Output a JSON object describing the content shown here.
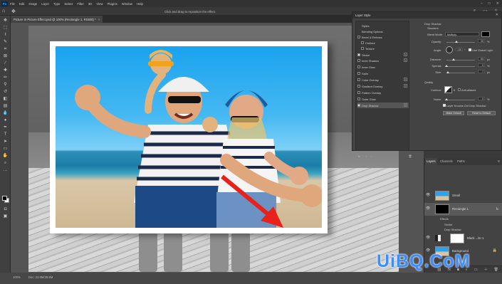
{
  "app": {
    "logo": "Ps",
    "menu": [
      "File",
      "Edit",
      "Image",
      "Layer",
      "Type",
      "Select",
      "Filter",
      "3D",
      "View",
      "Plugins",
      "Window",
      "Help"
    ],
    "window_buttons": [
      "–",
      "□",
      "✕"
    ]
  },
  "options_bar": {
    "hint": "Click and drag to reposition the effect."
  },
  "document_tab": {
    "title": "Picture In Picture Effect.psd @ 100% (Rectangle 1, RGB/8) *",
    "close": "×"
  },
  "layer_style": {
    "title": "Layer Style",
    "close": "✕",
    "list": [
      {
        "label": "Styles",
        "checkbox": false,
        "checked": false,
        "plus": false,
        "selected": false
      },
      {
        "label": "Blending Options",
        "checkbox": false,
        "checked": false,
        "plus": false,
        "selected": false
      },
      {
        "label": "Bevel & Emboss",
        "checkbox": true,
        "checked": false,
        "plus": false,
        "selected": false
      },
      {
        "label": "Contour",
        "checkbox": true,
        "checked": false,
        "plus": false,
        "selected": false
      },
      {
        "label": "Texture",
        "checkbox": true,
        "checked": false,
        "plus": false,
        "selected": false
      },
      {
        "label": "Stroke",
        "checkbox": true,
        "checked": true,
        "plus": true,
        "selected": false
      },
      {
        "label": "Inner Shadow",
        "checkbox": true,
        "checked": false,
        "plus": true,
        "selected": false
      },
      {
        "label": "Inner Glow",
        "checkbox": true,
        "checked": false,
        "plus": false,
        "selected": false
      },
      {
        "label": "Satin",
        "checkbox": true,
        "checked": false,
        "plus": false,
        "selected": false
      },
      {
        "label": "Color Overlay",
        "checkbox": true,
        "checked": false,
        "plus": true,
        "selected": false
      },
      {
        "label": "Gradient Overlay",
        "checkbox": true,
        "checked": false,
        "plus": true,
        "selected": false
      },
      {
        "label": "Pattern Overlay",
        "checkbox": true,
        "checked": false,
        "plus": false,
        "selected": false
      },
      {
        "label": "Outer Glow",
        "checkbox": true,
        "checked": false,
        "plus": false,
        "selected": false
      },
      {
        "label": "Drop Shadow",
        "checkbox": true,
        "checked": true,
        "plus": true,
        "selected": true
      }
    ],
    "fx_label": "fx",
    "drop_shadow": {
      "heading": "Drop Shadow",
      "structure": "Structure",
      "blend_mode_label": "Blend Mode:",
      "blend_mode": "Multiply",
      "shadow_color": "#000000",
      "opacity_label": "Opacity:",
      "opacity": "35",
      "opacity_level": 0.35,
      "angle_label": "Angle:",
      "angle": "136",
      "angle_unit": "°",
      "global_light": "Use Global Light",
      "distance_label": "Distance:",
      "distance": "65",
      "distance_level": 0.26,
      "spread_label": "Spread:",
      "spread": "0",
      "spread_level": 0.0,
      "size_label": "Size:",
      "size": "7",
      "size_level": 0.05,
      "px": "px",
      "pct": "%",
      "quality": "Quality",
      "contour_label": "Contour:",
      "anti_aliased": "Anti-aliased",
      "noise_label": "Noise:",
      "noise": "0",
      "noise_level": 0.0,
      "knockout": "Layer Knocks Out Drop Shadow",
      "make_default": "Make Default",
      "reset_default": "Reset to Default"
    }
  },
  "layers_panel": {
    "tabs": [
      "Layers",
      "Channels",
      "Paths"
    ],
    "layers": [
      {
        "name": "Small",
        "selected": false,
        "thumb": "photo"
      },
      {
        "name": "Rectangle 1",
        "selected": true,
        "thumb": "black",
        "fx": "fx"
      },
      {
        "name": "Black ...ite 1",
        "selected": false,
        "thumb": "white"
      },
      {
        "name": "Background",
        "selected": false,
        "thumb": "photo"
      }
    ],
    "effects_label": "Effects",
    "effects": [
      "Stroke",
      "Drop Shadow"
    ]
  },
  "status_bar": {
    "zoom": "100%",
    "doc": "Doc: 22.0M/29.8M"
  },
  "watermark": "UiBQ.CoM",
  "colors": {
    "accent": "#31a8ff",
    "arrow": "#e8221a",
    "watermark": "#3c8dff"
  }
}
